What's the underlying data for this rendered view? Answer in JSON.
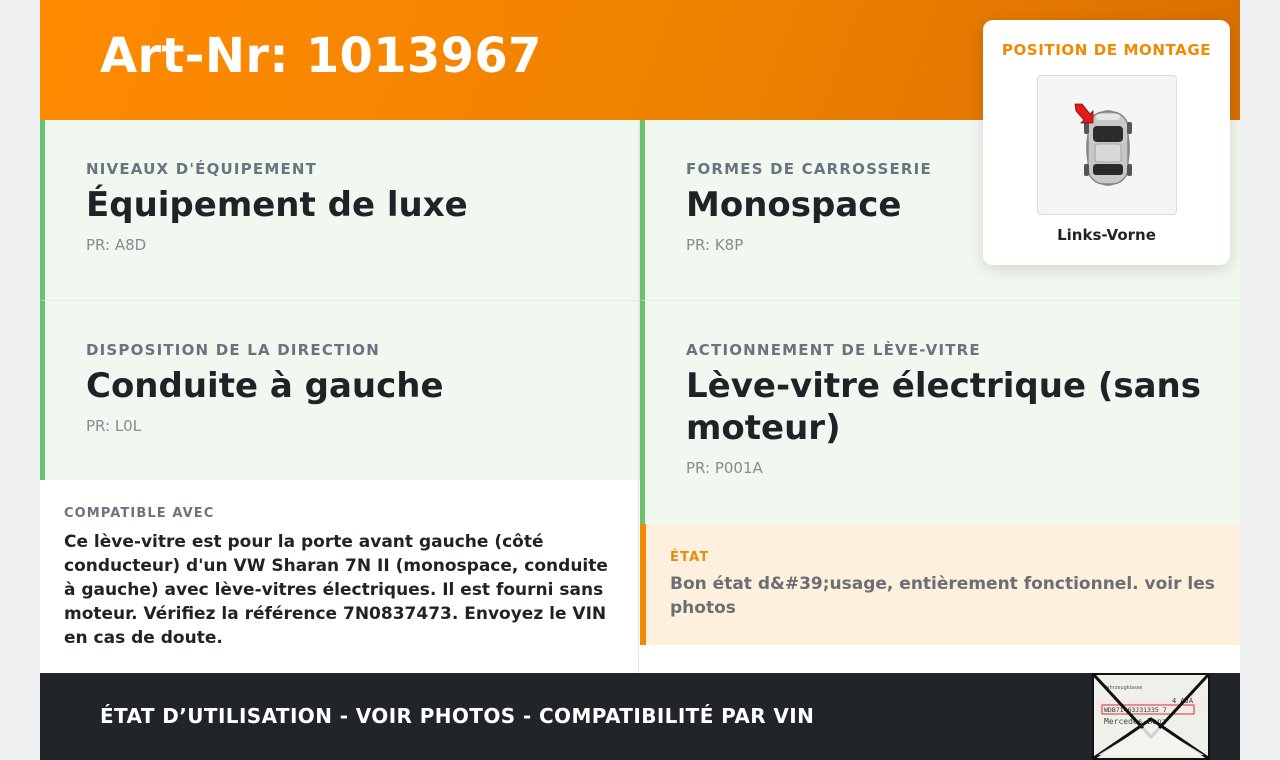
{
  "header": {
    "title": "Art-Nr: 1013967"
  },
  "specs": [
    {
      "label": "NIVEAUX D'ÉQUIPEMENT",
      "value": "Équipement de luxe",
      "pr": "PR: A8D"
    },
    {
      "label": "FORMES DE CARROSSERIE",
      "value": "Monospace",
      "pr": "PR: K8P"
    },
    {
      "label": "DISPOSITION DE LA DIRECTION",
      "value": "Conduite à gauche",
      "pr": "PR: L0L"
    },
    {
      "label": "ACTIONNEMENT DE LÈVE-VITRE",
      "value": "Lève-vitre électrique (sans moteur)",
      "pr": "PR: P001A"
    }
  ],
  "compatibility": {
    "label": "COMPATIBLE AVEC",
    "text": "Ce lève-vitre est pour la porte avant gauche (côté conducteur) d'un VW Sharan 7N II (monospace, conduite à gauche) avec lève-vitres électriques. Il est fourni sans moteur. Vérifiez la référence 7N0837473. Envoyez le VIN en cas de doute."
  },
  "condition": {
    "label": "ÉTAT",
    "text": "Bon état d&#39;usage, entièrement fonctionnel. voir les photos"
  },
  "mounting": {
    "title": "POSITION DE MONTAGE",
    "caption": "Links-Vorne",
    "image_icon": "car-top-view-icon",
    "marker_icon": "red-arrow-icon"
  },
  "footer": {
    "text": "ÉTAT D’UTILISATION - VOIR PHOTOS - COMPATIBILITÉ PAR VIN",
    "thumbnail_icon": "registration-document-icon",
    "thumbnail_text": {
      "top": "Fahrzeugklasse",
      "codes": "4 AJA",
      "vin": "WDB71463J31335 7",
      "maker": "Mercedes-Benz"
    }
  },
  "colors": {
    "header": "#f08200",
    "accent_green": "#6cc26e",
    "cell_bg": "#f0f8f0",
    "etat_bg": "#fdf0dc",
    "etat_accent": "#f08a00",
    "footer_bg": "#212428",
    "marker": "#e31b1b"
  }
}
